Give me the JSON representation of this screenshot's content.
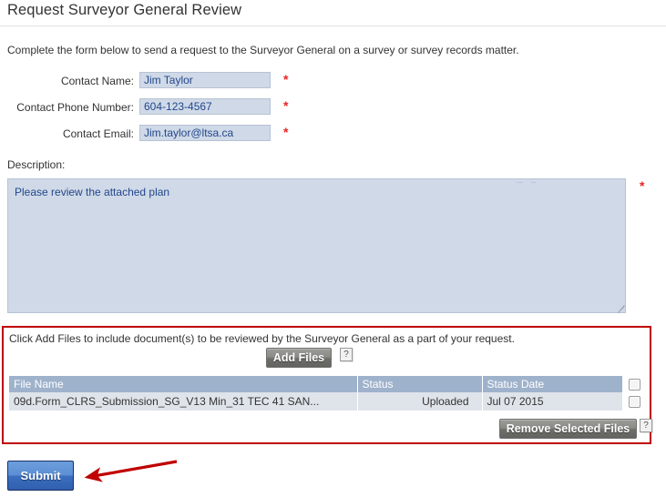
{
  "page": {
    "title": "Request Surveyor General Review",
    "intro": "Complete the form below to send a request to the Surveyor General on a survey or survey records matter.",
    "required_marker": "*"
  },
  "form": {
    "fields": [
      {
        "label": "Contact Name:",
        "value": "Jim Taylor",
        "placeholder": "",
        "required": true
      },
      {
        "label": "Contact Phone Number:",
        "value": "604-123-4567",
        "placeholder": "",
        "required": true
      },
      {
        "label": "Contact Email:",
        "value": "Jim.taylor@ltsa.ca",
        "placeholder": "",
        "required": true
      }
    ],
    "description": {
      "label": "Description:",
      "value": "Please review the attached plan",
      "placeholder": "",
      "required": true
    }
  },
  "files_panel": {
    "instruction": "Click Add Files to include document(s) to be reviewed by the Surveyor General as a part of your request.",
    "add_files_label": "Add Files",
    "remove_files_label": "Remove Selected Files",
    "help_label": "?",
    "table": {
      "columns": [
        "File Name",
        "Status",
        "Status Date"
      ],
      "rows": [
        {
          "file_name": "09d.Form_CLRS_Submission_SG_V13 Min_31 TEC 41 SAN...",
          "status": "Uploaded",
          "status_date": "Jul 07 2015",
          "selected": false
        }
      ],
      "header_select_all": false
    }
  },
  "footer": {
    "submit_label": "Submit"
  },
  "colors": {
    "accent_blue": "#3a6fc0",
    "required_red": "#ee2222",
    "annotation_red": "#c00000",
    "panel_border_red": "#c00000",
    "input_fill": "#cfd9e7",
    "input_text": "#23478c",
    "table_header": "#9fb2cc",
    "table_row": "#dfe4ea"
  },
  "icons": {
    "help": "?",
    "resize_grip": "resize-grip-icon",
    "annotation_arrow": "left-arrow-icon"
  }
}
